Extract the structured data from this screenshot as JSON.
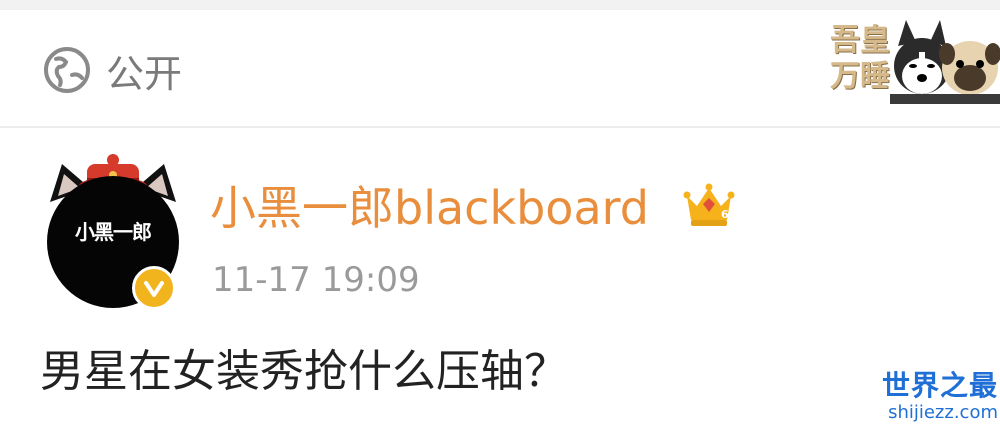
{
  "visibility": {
    "label": "公开",
    "icon": "globe-icon"
  },
  "sticker": {
    "icon": "husky-pug-sticker-icon",
    "text_line1": "吾皇",
    "text_line2": "万睡"
  },
  "post": {
    "author": {
      "name": "小黑一郎blackboard",
      "avatar_text": "小黑一郎",
      "verified_icon": "verified-badge-icon",
      "badge_icon": "crown-icon",
      "badge_level": "6"
    },
    "timestamp": "11-17 19:09",
    "content": "男星在女装秀抢什么压轴？"
  },
  "watermark": {
    "brand": "世界之最",
    "url": "shijiezz.com"
  },
  "colors": {
    "username": "#e88e3c",
    "verified": "#f2b41c",
    "watermark": "#1f6fd6",
    "muted": "#9a9a9a"
  }
}
